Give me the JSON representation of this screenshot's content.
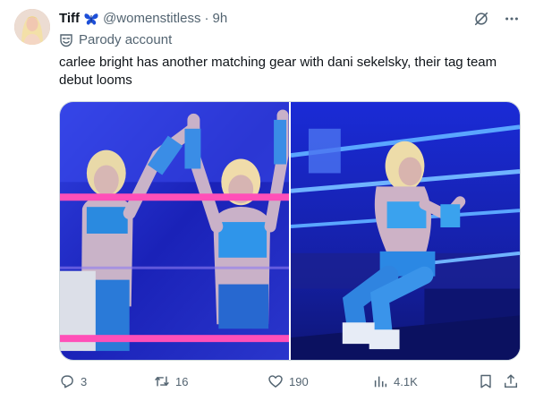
{
  "tweet": {
    "author_name": "Tiff",
    "author_handle": "@womenstitless",
    "separator": "·",
    "time": "9h",
    "badge_label": "Parody account",
    "text": "carlee bright has another matching gear with dani sekelsky, their tag team debut looms"
  },
  "icons": {
    "name_emoji": "butterfly-icon",
    "header_actions": [
      "grok-icon",
      "more-icon"
    ],
    "badge": "parody-mask-icon",
    "footer": [
      "reply-icon",
      "retweet-icon",
      "like-icon",
      "views-icon",
      "bookmark-icon",
      "share-icon"
    ]
  },
  "metrics": {
    "replies": "3",
    "retweets": "16",
    "likes": "190",
    "views": "4.1K"
  },
  "media": {
    "count": 2,
    "accent_colors": [
      "#1a2fd6",
      "#ff4fb8",
      "#5aa6ff"
    ]
  },
  "colors": {
    "text_primary": "#0f1419",
    "text_secondary": "#536471",
    "border": "#cfd9de",
    "butterfly": "#1d4fd8"
  }
}
